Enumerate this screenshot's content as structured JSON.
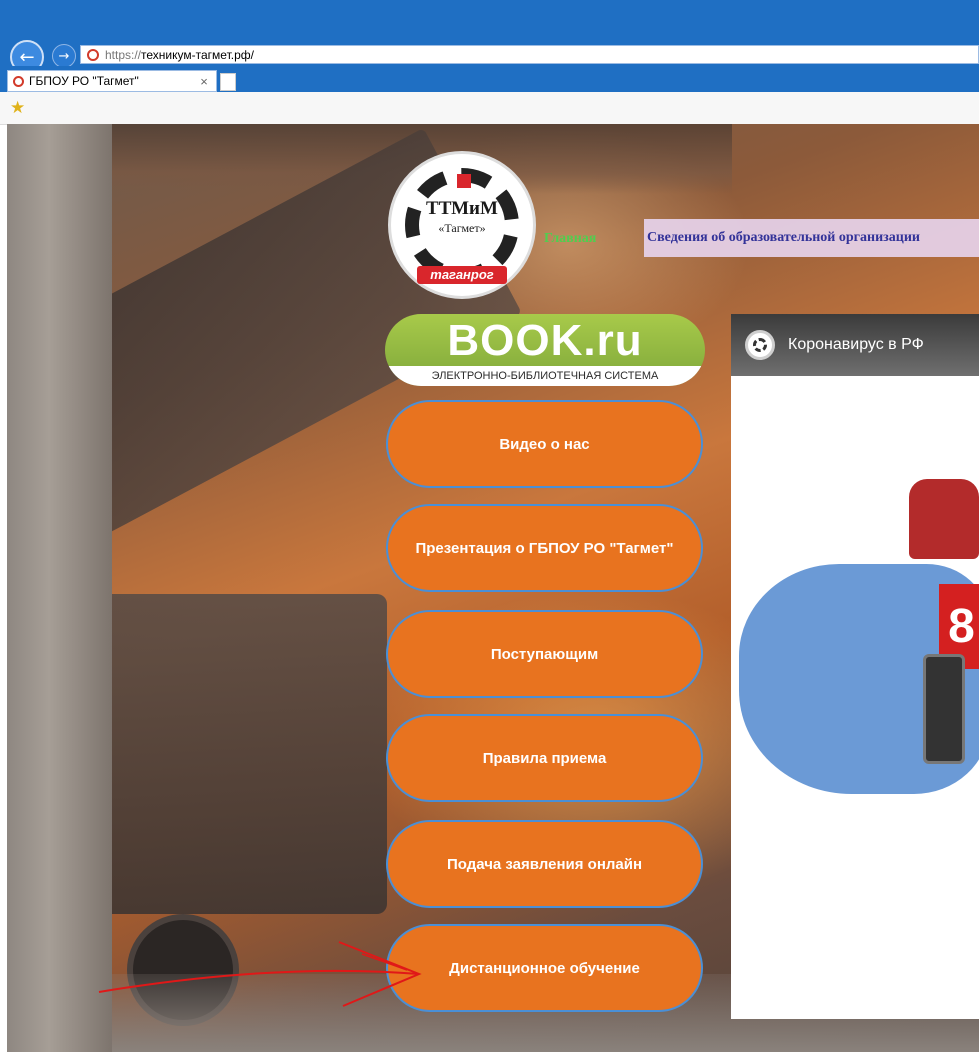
{
  "browser": {
    "url_scheme": "https://",
    "url_host": "техникум-тагмет.рф/",
    "tab_title": "ГБПОУ РО \"Тагмет\"",
    "tab_close": "×",
    "back_icon": "←",
    "forward_icon": "→",
    "favorites_icon": "★"
  },
  "logo": {
    "title": "ТТМиМ",
    "subtitle": "«Тагмет»",
    "city": "таганрог"
  },
  "nav": {
    "home": "Главная",
    "info": "Сведения об образовательной организации"
  },
  "banner": {
    "logo": "BOOK.ru",
    "subtitle": "ЭЛЕКТРОННО-БИБЛИОТЕЧНАЯ СИСТЕМА"
  },
  "menu": [
    {
      "label": "Видео о нас"
    },
    {
      "label": "Презентация о ГБПОУ РО \"Тагмет\""
    },
    {
      "label": "Поступающим"
    },
    {
      "label": "Правила приема"
    },
    {
      "label": "Подача заявления онлайн"
    },
    {
      "label": "Дистанционное обучение"
    }
  ],
  "video": {
    "title": "Коронавирус в РФ",
    "number_fragment": "8"
  },
  "colors": {
    "button": "#e8731f",
    "button_border": "#4a8fd6",
    "nav_home": "#4fcf4f",
    "nav_info": "#333399",
    "chrome": "#1f6fc3",
    "annotation": "#e01818"
  }
}
